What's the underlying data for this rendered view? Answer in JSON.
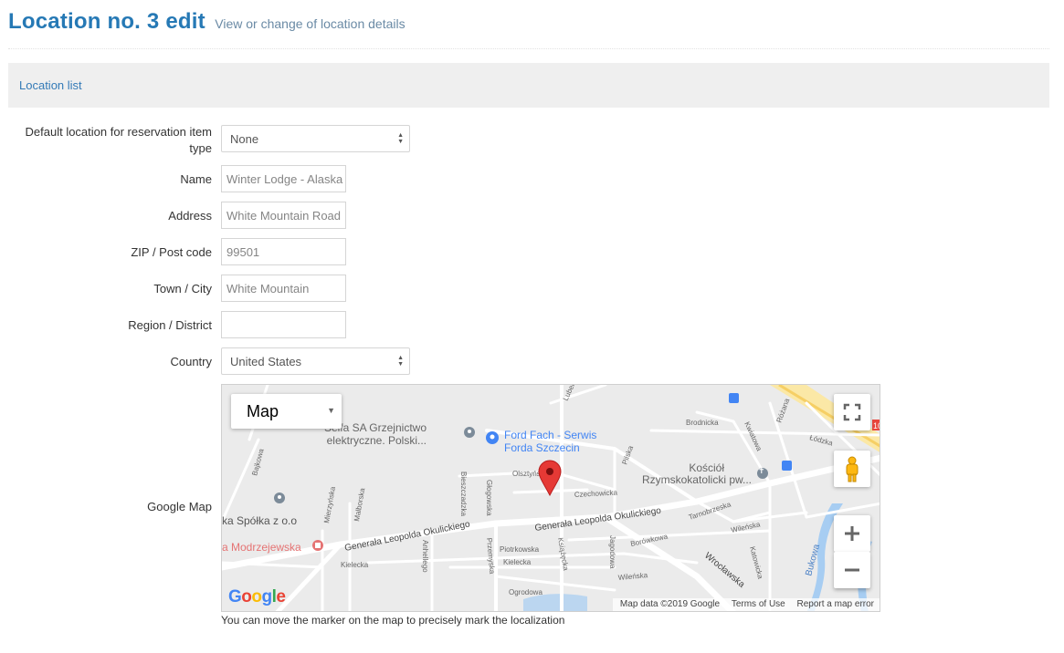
{
  "header": {
    "title": "Location no. 3 edit",
    "subtitle": "View or change of location details"
  },
  "toolbar": {
    "location_list_link": "Location list"
  },
  "form": {
    "default_type_label": "Default location for reservation item type",
    "default_type_value": "None",
    "name_label": "Name",
    "name_value": "Winter Lodge - Alaska",
    "address_label": "Address",
    "address_value": "White Mountain Road",
    "zip_label": "ZIP / Post code",
    "zip_value": "99501",
    "town_label": "Town / City",
    "town_value": "White Mountain",
    "region_label": "Region / District",
    "region_value": "",
    "country_label": "Country",
    "country_value": "United States",
    "map_label": "Google Map",
    "map_hint": "You can move the marker on the map to precisely mark the localization"
  },
  "map": {
    "type_selector": "Map",
    "footer_data": "Map data ©2019 Google",
    "footer_terms": "Terms of Use",
    "footer_report": "Report a map error",
    "logo": "Google",
    "pois": {
      "selfa": "Selfa SA Grzejnictwo\nelektryczne. Polski...",
      "ford": "Ford Fach - Serwis\nForda Szczecin",
      "kosciol": "Kościół\nRzymskokatolicki pw...",
      "spolka": "ka Spółka z o.o",
      "modrzejewska": "a Modrzejewska"
    },
    "streets": {
      "okulickiego_w": "Generała Leopolda Okulickiego",
      "okulickiego_e": "Generała Leopolda Okulickiego",
      "wroclawska": "Wrocławska",
      "czechowicka": "Czechowicka",
      "olsztynska": "Olsztyńs...",
      "brodnicka": "Brodnicka",
      "kwiatowa": "Kwiatowa",
      "rozana": "Różana",
      "lodzka": "Łódzka",
      "pilska": "Pilska",
      "bieszczadzka": "Bieszczadzka",
      "glogowska": "Głogowska",
      "mierzynska": "Mierzyńska",
      "malborska": "Malborska",
      "bajkowa": "Bajkowa",
      "lubelska": "Lubel...",
      "tarnobrzeska": "Tarnobrzeska",
      "wilenska": "Wileńska",
      "wilenska2": "Wileńska",
      "katowicka": "Katowicka",
      "borowkowa": "Borówkowa",
      "jagodowa": "Jagodowa",
      "piotrkowska": "Piotrkowska",
      "kielecka": "Kielecka",
      "kielecka2": "Kielecka",
      "ksiazecka": "Książęcka",
      "przemyska": "Przemyska",
      "anhellego": "Anhellego",
      "ogrodowa": "Ogrodowa",
      "bukowa": "Bukowa",
      "road_num": "10"
    }
  },
  "colors": {
    "title": "#2679b5",
    "link": "#337ab7",
    "marker": "#e53935",
    "poi_blue": "#4285f4",
    "poi_gray": "#7c8b99",
    "poi_red": "#e57373"
  }
}
